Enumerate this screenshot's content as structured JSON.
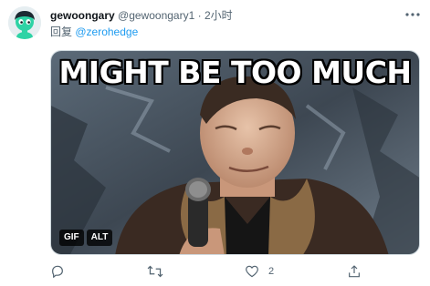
{
  "tweet": {
    "display_name": "gewoongary",
    "handle": "@gewoongary1",
    "separator": "·",
    "time": "2小时",
    "reply_label": "回复",
    "reply_handle": "@zerohedge",
    "media": {
      "caption": "MIGHT BE TOO MUCH",
      "badges": {
        "gif": "GIF",
        "alt": "ALT"
      }
    },
    "actions": {
      "reply_icon": "reply-icon",
      "retweet_icon": "retweet-icon",
      "like_icon": "heart-icon",
      "like_count": "2",
      "share_icon": "share-icon"
    }
  },
  "colors": {
    "accent": "#1d9bf0",
    "secondary_text": "#536471",
    "primary_text": "#0f1419",
    "avatar_green": "#2ed3a5"
  }
}
